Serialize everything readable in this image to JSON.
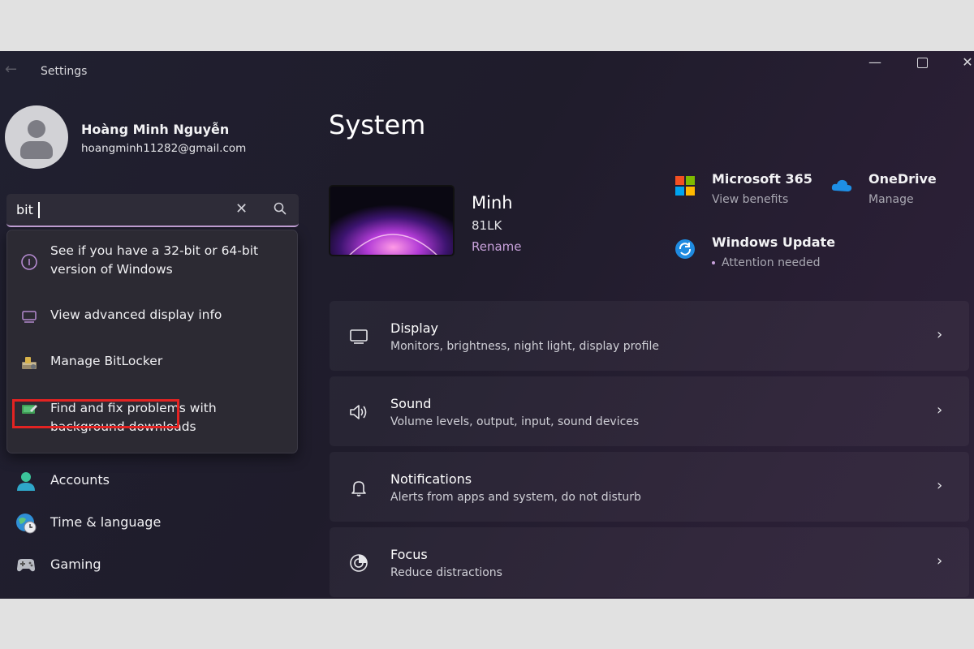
{
  "window": {
    "title": "Settings",
    "controls": {
      "minimize": "—",
      "close": "✕"
    }
  },
  "profile": {
    "name": "Hoàng Minh Nguyễn",
    "email": "hoangminh11282@gmail.com"
  },
  "search": {
    "value": "bit",
    "clear_glyph": "✕"
  },
  "suggestions": [
    {
      "label": "See if you have a 32-bit or 64-bit version of Windows",
      "icon": "info-icon"
    },
    {
      "label": "View advanced display info",
      "icon": "monitor-icon"
    },
    {
      "label": "Manage BitLocker",
      "icon": "bitlocker-icon",
      "highlighted": true
    },
    {
      "label": "Find and fix problems with background downloads",
      "icon": "troubleshoot-icon"
    }
  ],
  "sidebar": {
    "items": [
      {
        "label": "Accounts",
        "icon": "accounts-icon"
      },
      {
        "label": "Time & language",
        "icon": "globe-clock-icon"
      },
      {
        "label": "Gaming",
        "icon": "gamepad-icon"
      }
    ]
  },
  "main": {
    "title": "System",
    "device": {
      "name": "Minh",
      "model": "81LK",
      "rename": "Rename"
    },
    "quick_links": [
      {
        "title": "Microsoft 365",
        "subtitle": "View benefits",
        "icon": "microsoft-365-icon"
      },
      {
        "title": "OneDrive",
        "subtitle": "Manage",
        "icon": "onedrive-icon"
      },
      {
        "title": "Windows Update",
        "subtitle": "Attention needed",
        "icon": "windows-update-icon"
      }
    ],
    "cards": [
      {
        "title": "Display",
        "subtitle": "Monitors, brightness, night light, display profile",
        "icon": "display-icon"
      },
      {
        "title": "Sound",
        "subtitle": "Volume levels, output, input, sound devices",
        "icon": "speaker-icon"
      },
      {
        "title": "Notifications",
        "subtitle": "Alerts from apps and system, do not disturb",
        "icon": "bell-icon"
      },
      {
        "title": "Focus",
        "subtitle": "Reduce distractions",
        "icon": "focus-icon"
      }
    ],
    "chevron": "›"
  },
  "colors": {
    "accent": "#c9a2dc",
    "highlight_box": "#e32322",
    "window_bg": "#202030"
  }
}
